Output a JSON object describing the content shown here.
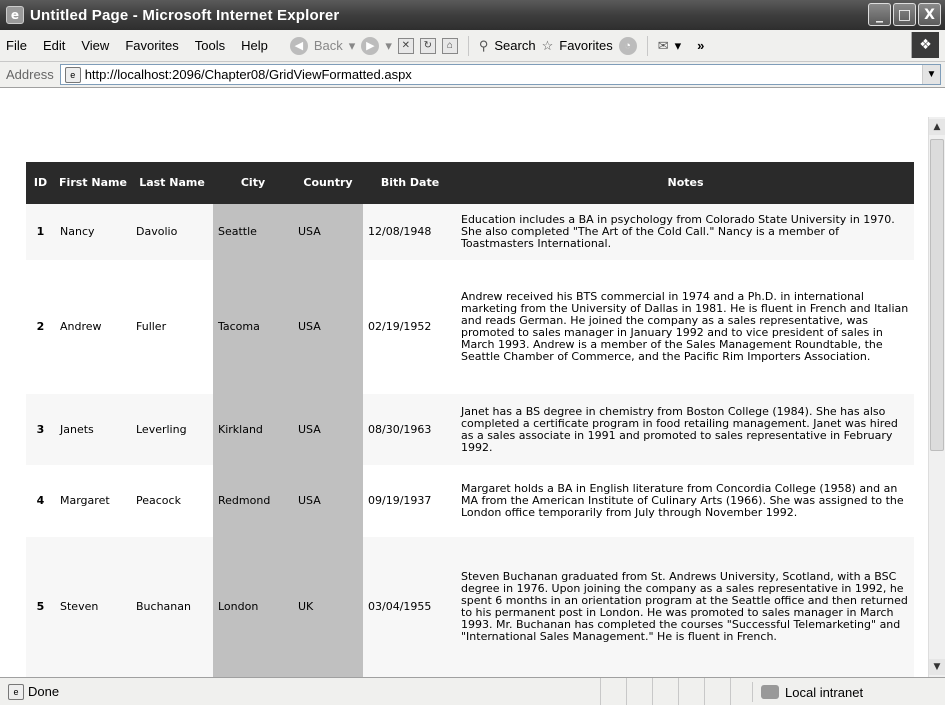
{
  "window": {
    "title": "Untitled Page - Microsoft Internet Explorer",
    "controls": {
      "minimize": "_",
      "maximize": "□",
      "close": "X"
    }
  },
  "menu": {
    "items": [
      "File",
      "Edit",
      "View",
      "Favorites",
      "Tools",
      "Help"
    ]
  },
  "toolbar": {
    "back_label": "Back",
    "search_label": "Search",
    "favorites_label": "Favorites",
    "chevron": "»"
  },
  "address": {
    "label": "Address",
    "url": "http://localhost:2096/Chapter08/GridViewFormatted.aspx"
  },
  "grid": {
    "headers": [
      "ID",
      "First Name",
      "Last Name",
      "City",
      "Country",
      "Bith Date",
      "Notes"
    ],
    "rows": [
      {
        "id": "1",
        "first": "Nancy",
        "last": "Davolio",
        "city": "Seattle",
        "country": "USA",
        "birth": "12/08/1948",
        "notes": "Education includes a BA in psychology from Colorado State University in 1970. She also completed \"The Art of the Cold Call.\" Nancy is a member of Toastmasters International."
      },
      {
        "id": "2",
        "first": "Andrew",
        "last": "Fuller",
        "city": "Tacoma",
        "country": "USA",
        "birth": "02/19/1952",
        "notes": "Andrew received his BTS commercial in 1974 and a Ph.D. in international marketing from the University of Dallas in 1981. He is fluent in French and Italian and reads German. He joined the company as a sales representative, was promoted to sales manager in January 1992 and to vice president of sales in March 1993. Andrew is a member of the Sales Management Roundtable, the Seattle Chamber of Commerce, and the Pacific Rim Importers Association."
      },
      {
        "id": "3",
        "first": "Janets",
        "last": "Leverling",
        "city": "Kirkland",
        "country": "USA",
        "birth": "08/30/1963",
        "notes": "Janet has a BS degree in chemistry from Boston College (1984). She has also completed a certificate program in food retailing management. Janet was hired as a sales associate in 1991 and promoted to sales representative in February 1992."
      },
      {
        "id": "4",
        "first": "Margaret",
        "last": "Peacock",
        "city": "Redmond",
        "country": "USA",
        "birth": "09/19/1937",
        "notes": "Margaret holds a BA in English literature from Concordia College (1958) and an MA from the American Institute of Culinary Arts (1966). She was assigned to the London office temporarily from July through November 1992."
      },
      {
        "id": "5",
        "first": "Steven",
        "last": "Buchanan",
        "city": "London",
        "country": "UK",
        "birth": "03/04/1955",
        "notes": "Steven Buchanan graduated from St. Andrews University, Scotland, with a BSC degree in 1976. Upon joining the company as a sales representative in 1992, he spent 6 months in an orientation program at the Seattle office and then returned to his permanent post in London. He was promoted to sales manager in March 1993. Mr. Buchanan has completed the courses \"Successful Telemarketing\" and \"International Sales Management.\" He is fluent in French."
      }
    ]
  },
  "status": {
    "text": "Done",
    "zone": "Local intranet"
  }
}
